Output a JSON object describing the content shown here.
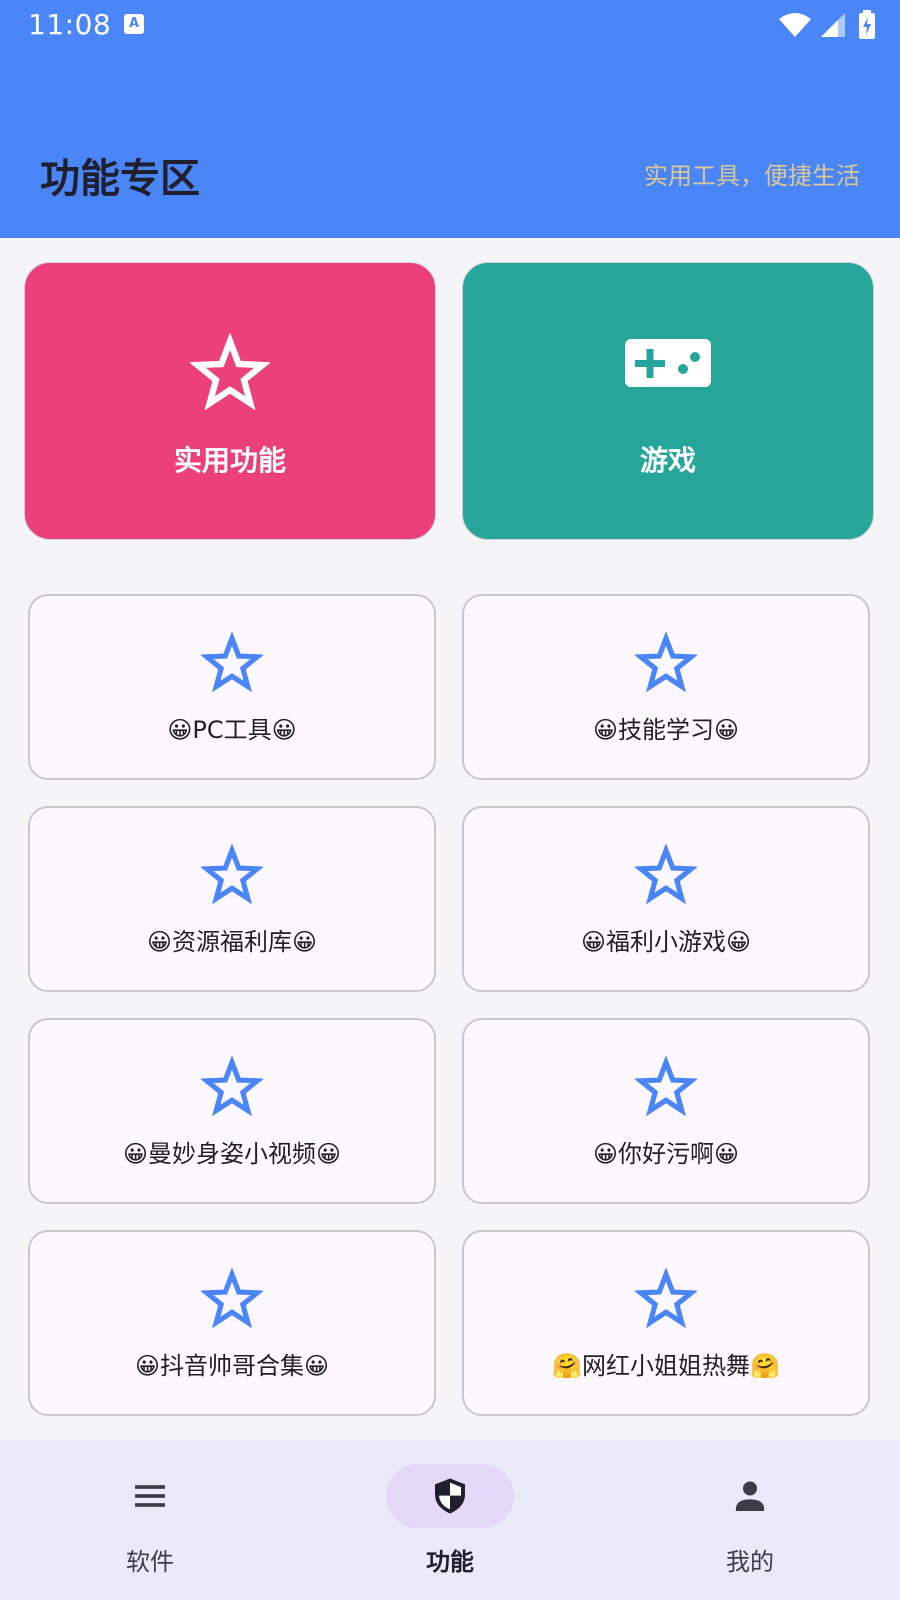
{
  "status_bar": {
    "time": "11:08",
    "notif_icon": "a-icon"
  },
  "header": {
    "title": "功能专区",
    "subtitle": "实用工具，便捷生活"
  },
  "featured": [
    {
      "label": "实用功能",
      "icon": "star-outline-icon",
      "color": "#ec407a"
    },
    {
      "label": "游戏",
      "icon": "gamepad-icon",
      "color": "#26a69a"
    }
  ],
  "grid": [
    {
      "label": "😀PC工具😀"
    },
    {
      "label": "😀技能学习😀"
    },
    {
      "label": "😀资源福利库😀"
    },
    {
      "label": "😀福利小游戏😀"
    },
    {
      "label": "😀曼妙身姿小视频😀"
    },
    {
      "label": "😀你好污啊😀"
    },
    {
      "label": "😀抖音帅哥合集😀"
    },
    {
      "label": "🤗网红小姐姐热舞🤗"
    }
  ],
  "bottom_nav": [
    {
      "label": "软件",
      "icon": "menu-icon",
      "active": false
    },
    {
      "label": "功能",
      "icon": "shield-icon",
      "active": true
    },
    {
      "label": "我的",
      "icon": "person-icon",
      "active": false
    }
  ],
  "colors": {
    "header_bg": "#4a86f7",
    "accent_star": "#4a86f7",
    "nav_bg": "#eaeafb"
  }
}
